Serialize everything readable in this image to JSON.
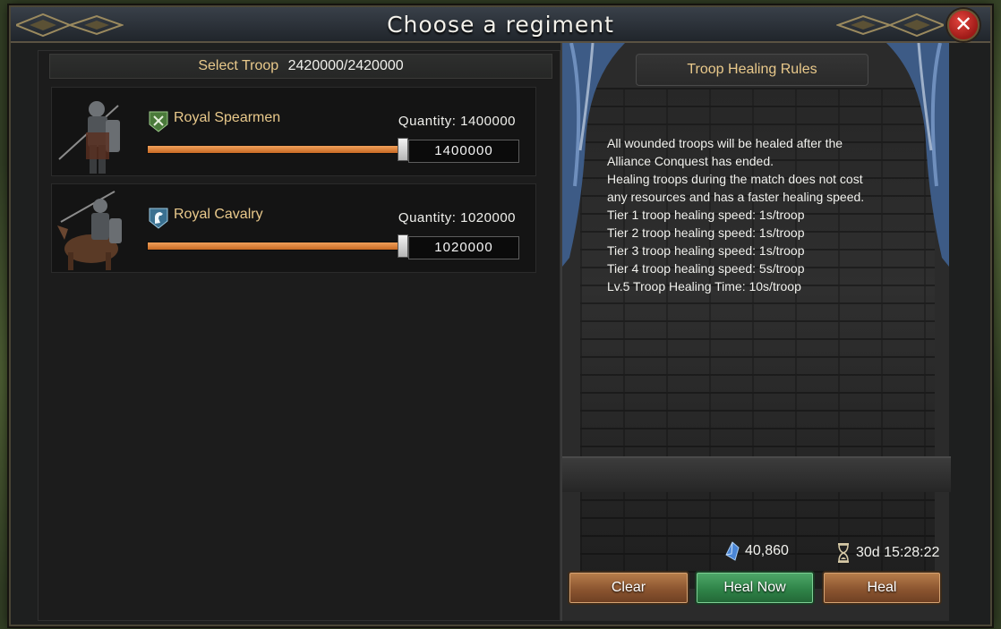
{
  "window": {
    "title": "Choose a regiment",
    "close_label": "✕"
  },
  "select": {
    "label": "Select Troop",
    "count": "2420000/2420000"
  },
  "troops": [
    {
      "name": "Royal Spearmen",
      "quantity_label": "Quantity: 1400000",
      "input_value": "1400000",
      "slider_fraction": 1.0,
      "badge_icon": "spear-badge-icon",
      "badge_color": "#4a7a3a"
    },
    {
      "name": "Royal Cavalry",
      "quantity_label": "Quantity: 1020000",
      "input_value": "1020000",
      "slider_fraction": 1.0,
      "badge_icon": "horse-badge-icon",
      "badge_color": "#3a7090"
    }
  ],
  "rules": {
    "title": "Troop Healing Rules",
    "lines": [
      "All wounded troops will be healed after the\nAlliance Conquest has ended.",
      "Healing troops during the match does not cost\nany resources and has a faster healing speed.",
      "Tier 1 troop healing speed: 1s/troop",
      "Tier 2 troop healing speed: 1s/troop",
      "Tier 3 troop healing speed: 1s/troop",
      "Tier 4 troop healing speed: 5s/troop",
      "Lv.5 Troop Healing Time: 10s/troop"
    ]
  },
  "footer": {
    "gems": "40,860",
    "timer": "30d 15:28:22",
    "clear_label": "Clear",
    "heal_now_label": "Heal Now",
    "heal_label": "Heal"
  },
  "colors": {
    "accent_gold": "#e9c98b",
    "slider_orange": "#e08a44",
    "heal_now_green": "#2f8448",
    "close_red": "#c42b25"
  }
}
